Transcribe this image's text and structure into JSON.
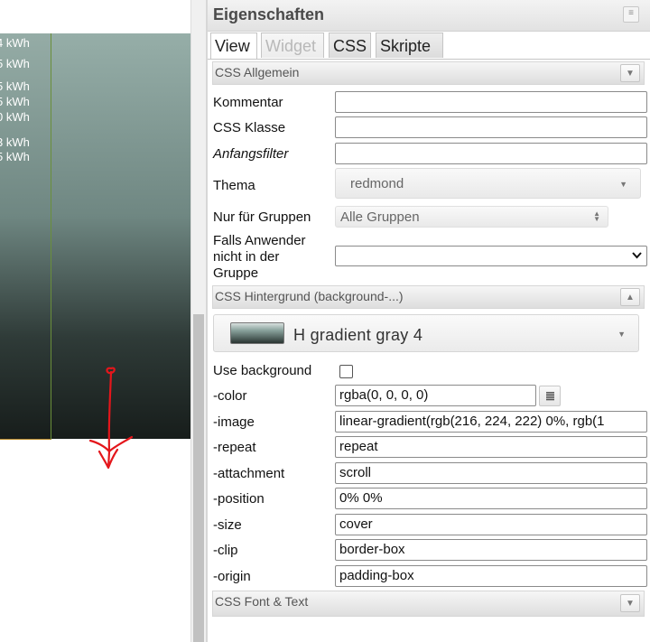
{
  "canvas": {
    "kwh_labels": [
      "4 kWh",
      "5 kWh",
      "5 kWh",
      "5 kWh",
      "0 kWh",
      "3 kWh",
      "5 kWh"
    ]
  },
  "panel": {
    "title": "Eigenschaften",
    "tabs": [
      {
        "label": "View",
        "state": "active"
      },
      {
        "label": "Widget",
        "state": "disabled"
      },
      {
        "label": "CSS",
        "state": "normal"
      },
      {
        "label": "Skripte",
        "state": "normal"
      }
    ],
    "sections": {
      "css_general": "CSS Allgemein",
      "css_background": "CSS Hintergrund (background-...)",
      "css_font": "CSS Font & Text"
    },
    "general": {
      "comment_label": "Kommentar",
      "comment_value": "",
      "css_class_label": "CSS Klasse",
      "css_class_value": "",
      "filter_label": "Anfangsfilter",
      "filter_value": "",
      "theme_label": "Thema",
      "theme_value": "redmond",
      "groups_label": "Nur für Gruppen",
      "groups_value": "Alle Gruppen",
      "not_in_group_label_1": "Falls Anwender",
      "not_in_group_label_2": "nicht in der",
      "not_in_group_label_3": "Gruppe",
      "not_in_group_value": ""
    },
    "background": {
      "preset": "H gradient gray 4",
      "use_background_label": "Use background",
      "use_background_checked": false,
      "color_label": "-color",
      "color_value": "rgba(0, 0, 0, 0)",
      "image_label": "-image",
      "image_value": "linear-gradient(rgb(216, 224, 222) 0%, rgb(1",
      "repeat_label": "-repeat",
      "repeat_value": "repeat",
      "attachment_label": "-attachment",
      "attachment_value": "scroll",
      "position_label": "-position",
      "position_value": "0% 0%",
      "size_label": "-size",
      "size_value": "cover",
      "clip_label": "-clip",
      "clip_value": "border-box",
      "origin_label": "-origin",
      "origin_value": "padding-box"
    }
  }
}
